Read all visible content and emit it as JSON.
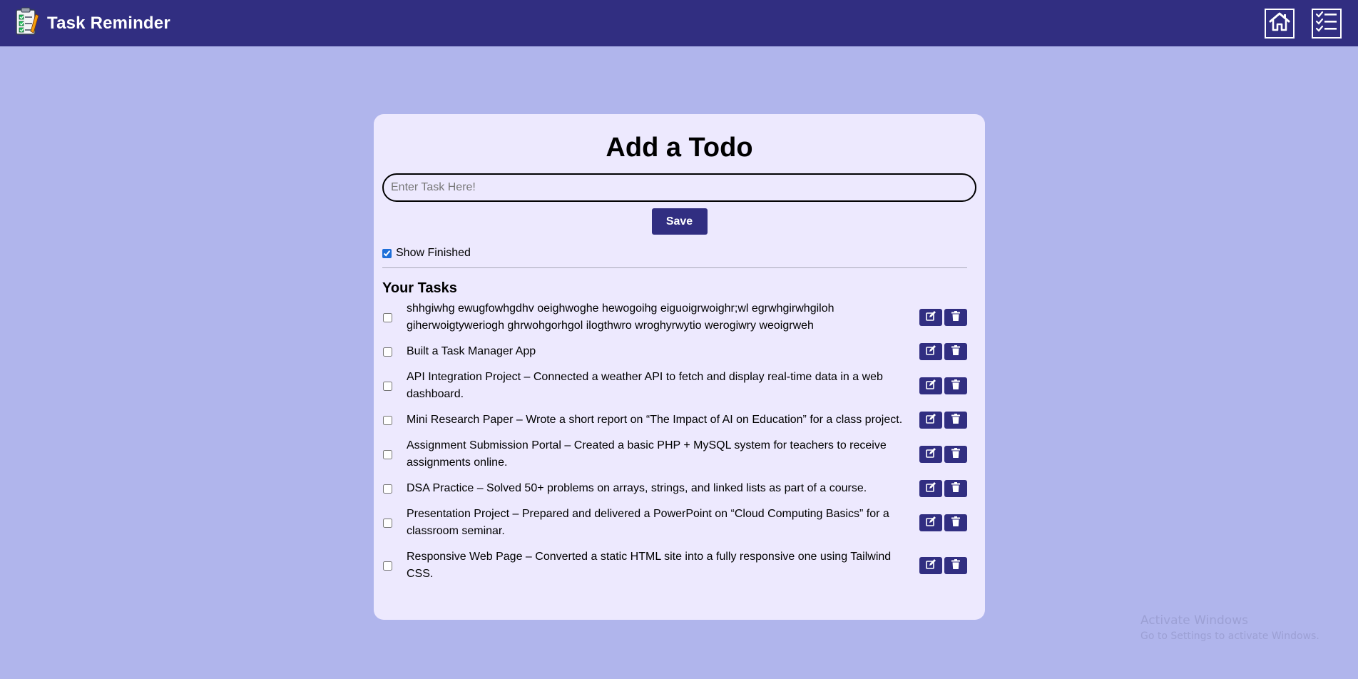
{
  "app": {
    "title": "Task Reminder"
  },
  "nav": {
    "items": [
      {
        "icon": "home-icon"
      },
      {
        "icon": "task-list-icon"
      }
    ]
  },
  "form": {
    "heading": "Add a Todo",
    "input_placeholder": "Enter Task Here!",
    "input_value": "",
    "save_label": "Save"
  },
  "filter": {
    "show_finished_label": "Show Finished",
    "show_finished_checked": true
  },
  "tasks_heading": "Your Tasks",
  "tasks": [
    {
      "text": "shhgiwhg ewugfowhgdhv oeighwoghe hewogoihg eiguoigrwoighr;wl egrwhgirwhgiloh giherwoigtyweriogh ghrwohgorhgol ilogthwro wroghyrwytio werogiwry weoigrweh",
      "done": false
    },
    {
      "text": "Built a Task Manager App",
      "done": false
    },
    {
      "text": "API Integration Project – Connected a weather API to fetch and display real-time data in a web dashboard.",
      "done": false
    },
    {
      "text": "Mini Research Paper – Wrote a short report on “The Impact of AI on Education” for a class project.",
      "done": false
    },
    {
      "text": "Assignment Submission Portal – Created a basic PHP + MySQL system for teachers to receive assignments online.",
      "done": false
    },
    {
      "text": "DSA Practice – Solved 50+ problems on arrays, strings, and linked lists as part of a course.",
      "done": false
    },
    {
      "text": "Presentation Project – Prepared and delivered a PowerPoint on “Cloud Computing Basics” for a classroom seminar.",
      "done": false
    },
    {
      "text": "Responsive Web Page – Converted a static HTML site into a fully responsive one using Tailwind CSS.",
      "done": false
    }
  ],
  "task_actions": {
    "edit_icon": "edit-icon",
    "delete_icon": "trash-icon"
  },
  "watermark": {
    "title": "Activate Windows",
    "subtitle": "Go to Settings to activate Windows."
  },
  "colors": {
    "navbar": "#312e81",
    "page_bg": "#b0b5ec",
    "card_bg": "#ede9fe",
    "button": "#312e81"
  }
}
